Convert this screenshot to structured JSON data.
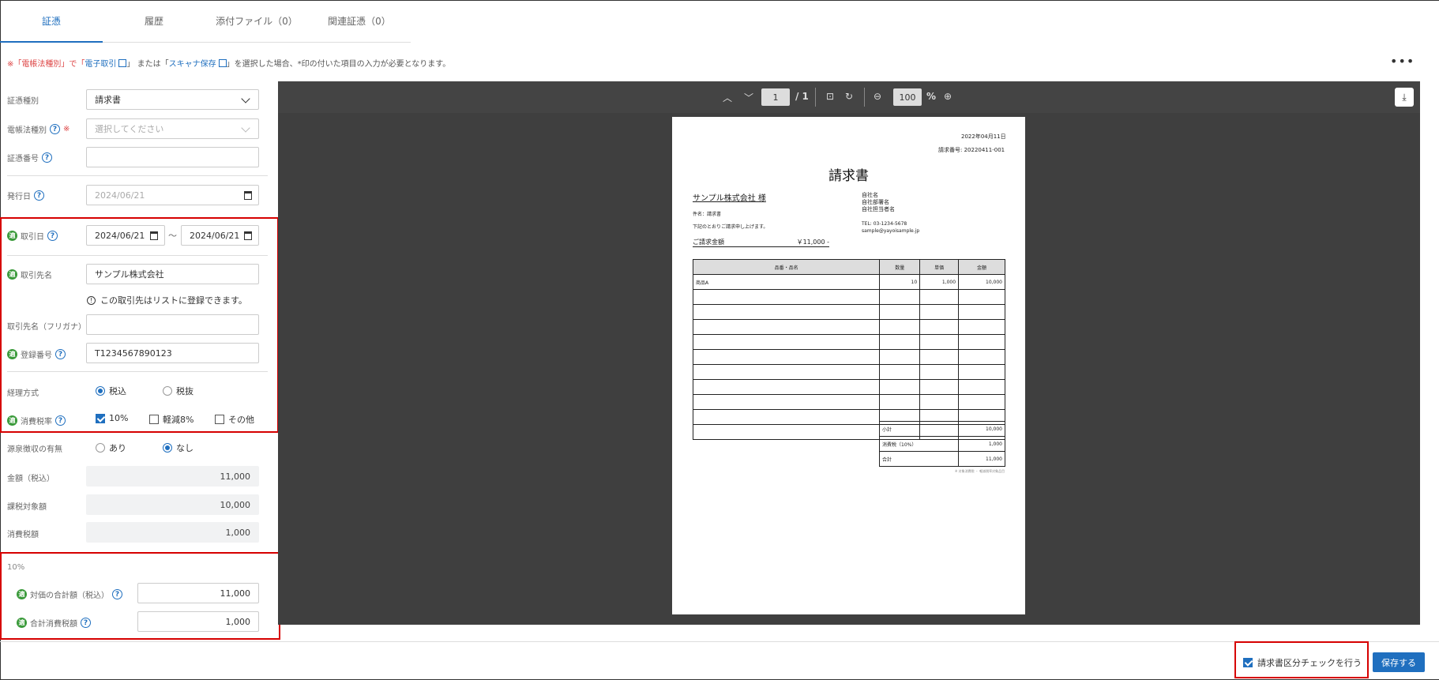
{
  "tabs": [
    "証憑",
    "履歴",
    "添付ファイル（0）",
    "関連証憑（0）"
  ],
  "notice": {
    "prefix": "※「電帳法種別」で「",
    "link1": "電子取引",
    "mid": "」 または「",
    "link2": "スキャナ保存",
    "suffix": "」を選択した場合、*印の付いた項目の入力が必要となります。"
  },
  "more_label": "•••",
  "form": {
    "shouhyou_type": {
      "label": "証憑種別",
      "value": "請求書"
    },
    "denchou_type": {
      "label": "電帳法種別",
      "placeholder": "選択してください",
      "required_mark": "※"
    },
    "shouhyou_no": {
      "label": "証憑番号",
      "value": ""
    },
    "issue_date": {
      "label": "発行日",
      "placeholder": "2024/06/21"
    },
    "trade_date": {
      "label": "取引日",
      "from": "2024/06/21",
      "sep": "〜",
      "to": "2024/06/21"
    },
    "partner": {
      "label": "取引先名",
      "value": "サンプル株式会社",
      "info": "この取引先はリストに登録できます。"
    },
    "partner_kana": {
      "label": "取引先名（フリガナ）",
      "value": ""
    },
    "reg_no": {
      "label": "登録番号",
      "value": "T1234567890123"
    },
    "accounting": {
      "label": "経理方式",
      "options": [
        "税込",
        "税抜"
      ],
      "selected": "税込"
    },
    "tax_rate": {
      "label": "消費税率",
      "options": [
        "10%",
        "軽減8%",
        "その他"
      ],
      "checked": [
        "10%"
      ]
    },
    "withholding": {
      "label": "源泉徴収の有無",
      "options": [
        "あり",
        "なし"
      ],
      "selected": "なし"
    },
    "amount": {
      "label": "金額（税込）",
      "value": "11,000"
    },
    "taxable": {
      "label": "課税対象額",
      "value": "10,000"
    },
    "tax": {
      "label": "消費税額",
      "value": "1,000"
    },
    "section10": {
      "heading": "10%",
      "total_label": "対価の合計額（税込）",
      "total_value": "11,000",
      "tax_label": "合計消費税額",
      "tax_value": "1,000"
    },
    "req_badge": "適"
  },
  "viewer": {
    "page_current": "1",
    "page_total": "/ 1",
    "zoom": "100",
    "zoom_unit": "%"
  },
  "invoice": {
    "date": "2022年04月11日",
    "number": "請求番号: 20220411-001",
    "title": "請求書",
    "to": "サンプル株式会社 様",
    "subject": "件名：請求書",
    "greeting": "下記のとおりご請求申し上げます。",
    "total_label": "ご請求金額",
    "total_value": "￥11,000 -",
    "from_lines": [
      "自社名",
      "自社部署名",
      "自社担当者名"
    ],
    "tel": "TEL: 03-1234-5678",
    "email": "sample@yayoisample.jp",
    "columns": [
      "品番・品名",
      "数量",
      "単価",
      "金額"
    ],
    "rows": [
      [
        "商品A",
        "10",
        "1,000",
        "10,000"
      ]
    ],
    "summary": [
      [
        "小計",
        "10,000"
      ],
      [
        "消費税（10%）",
        "1,000"
      ],
      [
        "合計",
        "11,000"
      ]
    ],
    "footnote": "※ 対象消費税 ・ 軽減税率対象品目"
  },
  "footer": {
    "check_label": "請求書区分チェックを行う",
    "save_label": "保存する"
  }
}
